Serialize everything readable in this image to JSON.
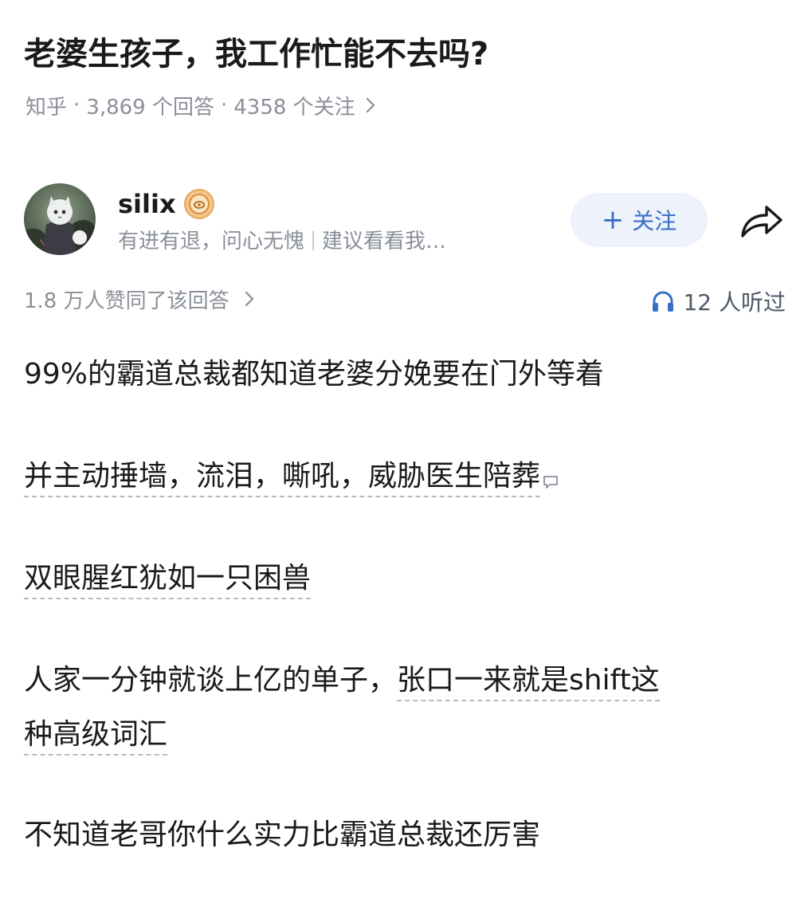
{
  "question": {
    "title": "老婆生孩子，我工作忙能不去吗?",
    "source": "知乎",
    "answer_count": "3,869 个回答",
    "follower_count": "4358 个关注"
  },
  "author": {
    "name": "silix",
    "bio": "有进有退，问心无愧",
    "bio_suffix": "建议看看我…",
    "follow_label": "关注",
    "icons": [
      "avatar",
      "badge-icon",
      "share-icon",
      "plus-icon"
    ]
  },
  "stats": {
    "likes_text": "1.8 万人赞同了该回答",
    "listeners_text": "12 人听过",
    "colors": {
      "accent": "#3a6fc8",
      "muted": "#8a8f99"
    }
  },
  "answer": {
    "p1": "99%的霸道总裁都知道老婆分娩要在门外等着",
    "p2": "并主动捶墙，流泪，嘶吼，威胁医生陪葬",
    "p3": "双眼腥红犹如一只困兽",
    "p4_a": "人家一分钟就谈上亿的单子，",
    "p4_b": "张口一来就是shift这",
    "p4_c": "种高级词汇",
    "p5": "不知道老哥你什么实力比霸道总裁还厉害"
  }
}
